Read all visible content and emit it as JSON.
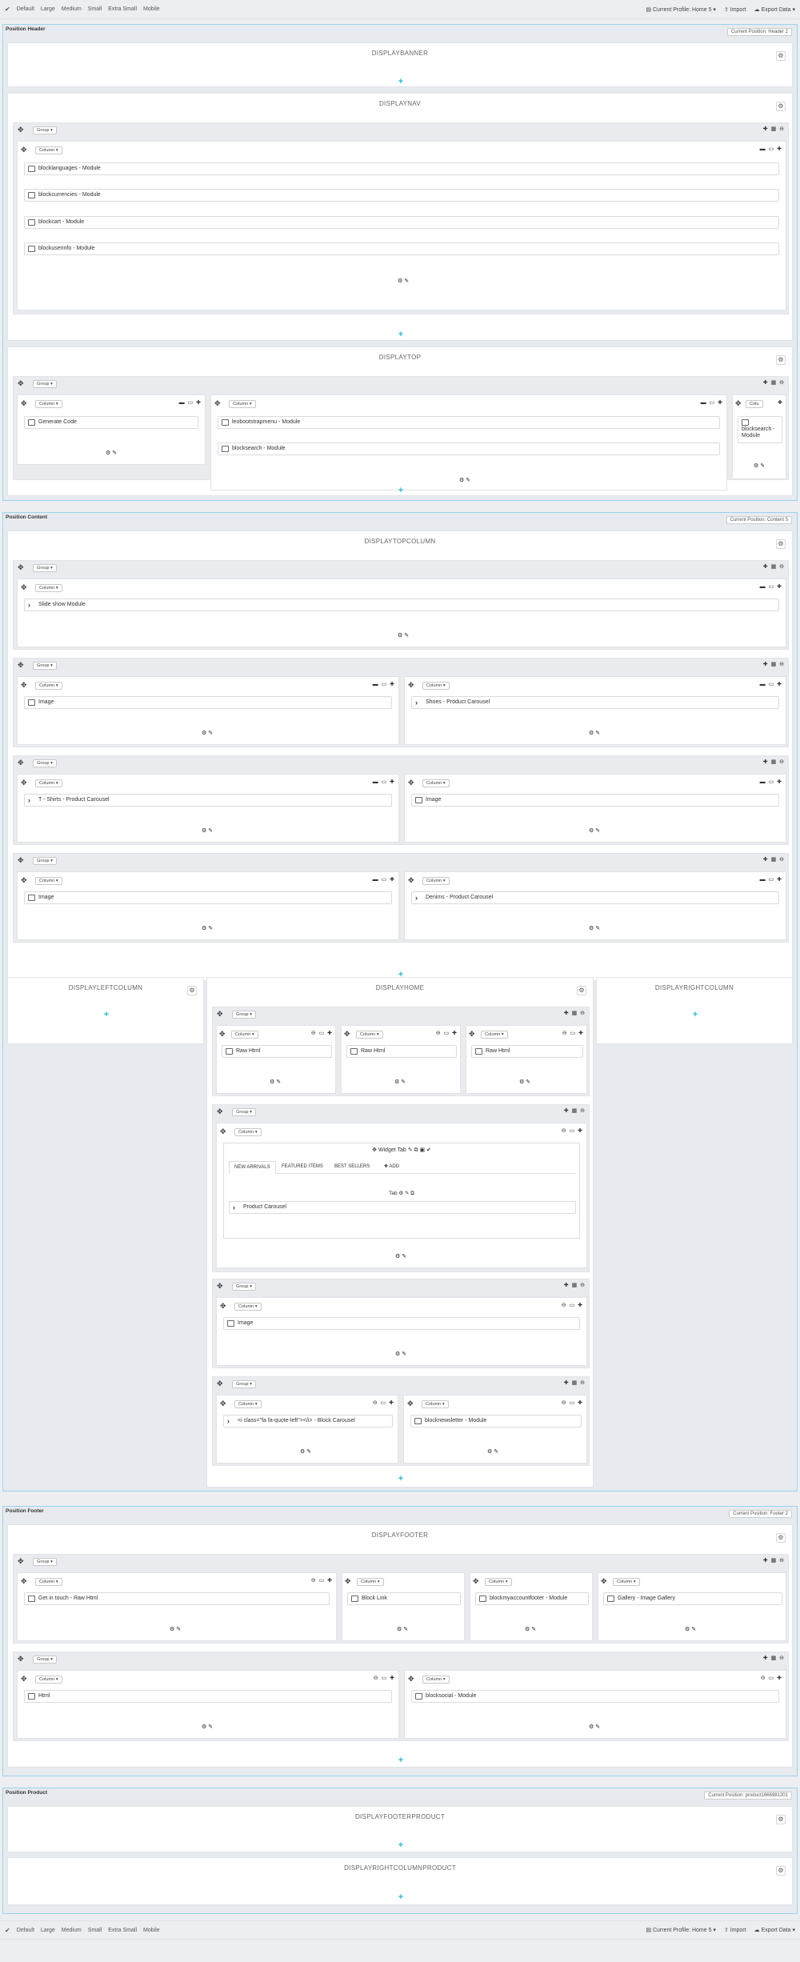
{
  "toolbar": {
    "devices": [
      "Default",
      "Large",
      "Medium",
      "Small",
      "Extra Small",
      "Mobile"
    ],
    "profile": "Current Profile: Home 5",
    "import": "Import",
    "export": "Export Data"
  },
  "header": {
    "title": "Position Header",
    "current": "Current Position: Header 2",
    "hooks": {
      "banner": "DISPLAYBANNER",
      "nav": "DISPLAYNAV",
      "top": "DISPLAYTOP"
    },
    "nav_widgets": [
      "blocklanguages - Module",
      "blockcurrencies - Module",
      "blockcart - Module",
      "blockuserinfo - Module"
    ],
    "top_widgets": {
      "col1": "Generate Code",
      "col2": [
        "leobootstrapmenu - Module",
        "blocksearch - Module"
      ],
      "col3": "blocksearch - Module",
      "col3_label": "Colu"
    }
  },
  "content": {
    "title": "Position Content",
    "current": "Current Position: Content 5",
    "hooks": {
      "topcolumn": "DISPLAYTOPCOLUMN",
      "left": "DISPLAYLEFTCOLUMN",
      "home": "DISPLAYHOME",
      "right": "DISPLAYRIGHTCOLUMN"
    },
    "slideshow": "Slide show Module",
    "rows": [
      [
        "Image",
        "Shoes - Product Carousel"
      ],
      [
        "T - Shirts - Product Carousel",
        "Image"
      ],
      [
        "Image",
        "Denims - Product Carousel"
      ]
    ],
    "home_raw": [
      "Raw Html",
      "Raw Html",
      "Raw Html"
    ],
    "widget_tab": "Widget Tab",
    "tabs": [
      "NEW ARRIVALS",
      "FEATURED ITEMS",
      "BEST SELLERS",
      "ADD"
    ],
    "tab_label": "Tab",
    "product_carousel": "Product Carousel",
    "home_image": "Image",
    "block_carousel": "<i class=\"fa fa-quote-left\"></i> - Block Carousel",
    "newsletter": "blocknewsletter - Module"
  },
  "footer": {
    "title": "Position Footer",
    "current": "Current Position: Footer 2",
    "hook": "DISPLAYFOOTER",
    "row1": [
      "Get in touch - Raw Html",
      "Block Link",
      "blockmyaccountfooter - Module",
      "Gallery - Image Gallery"
    ],
    "row2": [
      "Html",
      "blocksocial - Module"
    ]
  },
  "product": {
    "title": "Position Product",
    "current": "Current Position: product1666981201",
    "hooks": [
      "DISPLAYFOOTERPRODUCT",
      "DISPLAYRIGHTCOLUMNPRODUCT"
    ]
  },
  "labels": {
    "group": "Group",
    "column": "Column"
  }
}
